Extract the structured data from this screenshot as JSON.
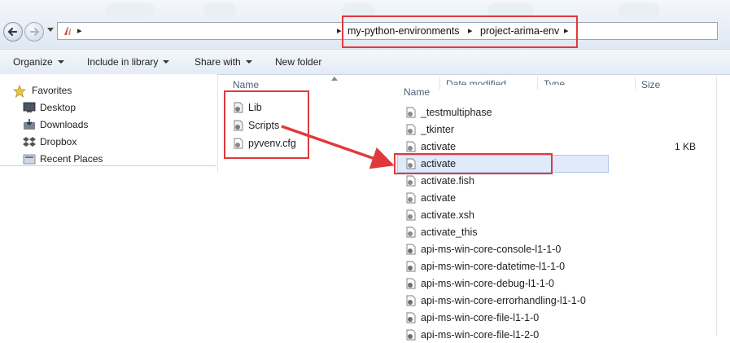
{
  "address_bar": {
    "crumbs": [
      "my-python-environments",
      "project-arima-env"
    ]
  },
  "toolbar": {
    "organize_label": "Organize",
    "include_label": "Include in library",
    "share_label": "Share with",
    "new_folder_label": "New folder"
  },
  "nav_pane": {
    "favorites_label": "Favorites",
    "items": [
      {
        "label": "Desktop",
        "icon": "desktop-icon"
      },
      {
        "label": "Downloads",
        "icon": "downloads-icon"
      },
      {
        "label": "Dropbox",
        "icon": "dropbox-icon"
      },
      {
        "label": "Recent Places",
        "icon": "recent-places-icon"
      }
    ]
  },
  "left_pane": {
    "column_name": "Name",
    "items": [
      {
        "label": "Lib",
        "icon": "folder-icon"
      },
      {
        "label": "Scripts",
        "icon": "folder-icon"
      },
      {
        "label": "pyvenv.cfg",
        "icon": "file-icon"
      }
    ]
  },
  "right_pane": {
    "columns": {
      "name": "Name",
      "date": "Date modified",
      "type": "Type",
      "size": "Size"
    },
    "files": [
      {
        "name": "_testmultiphase",
        "size": ""
      },
      {
        "name": "_tkinter",
        "size": ""
      },
      {
        "name": "activate",
        "size": "1 KB"
      },
      {
        "name": "activate",
        "size": "",
        "selected": true
      },
      {
        "name": "activate.fish",
        "size": ""
      },
      {
        "name": "activate",
        "size": ""
      },
      {
        "name": "activate.xsh",
        "size": ""
      },
      {
        "name": "activate_this",
        "size": ""
      },
      {
        "name": "api-ms-win-core-console-l1-1-0",
        "size": ""
      },
      {
        "name": "api-ms-win-core-datetime-l1-1-0",
        "size": ""
      },
      {
        "name": "api-ms-win-core-debug-l1-1-0",
        "size": ""
      },
      {
        "name": "api-ms-win-core-errorhandling-l1-1-0",
        "size": ""
      },
      {
        "name": "api-ms-win-core-file-l1-1-0",
        "size": ""
      },
      {
        "name": "api-ms-win-core-file-l1-2-0",
        "size": ""
      }
    ]
  },
  "colors": {
    "highlight": "#e0393c",
    "selection": "#dfeafa",
    "header_text": "#4c607a"
  }
}
